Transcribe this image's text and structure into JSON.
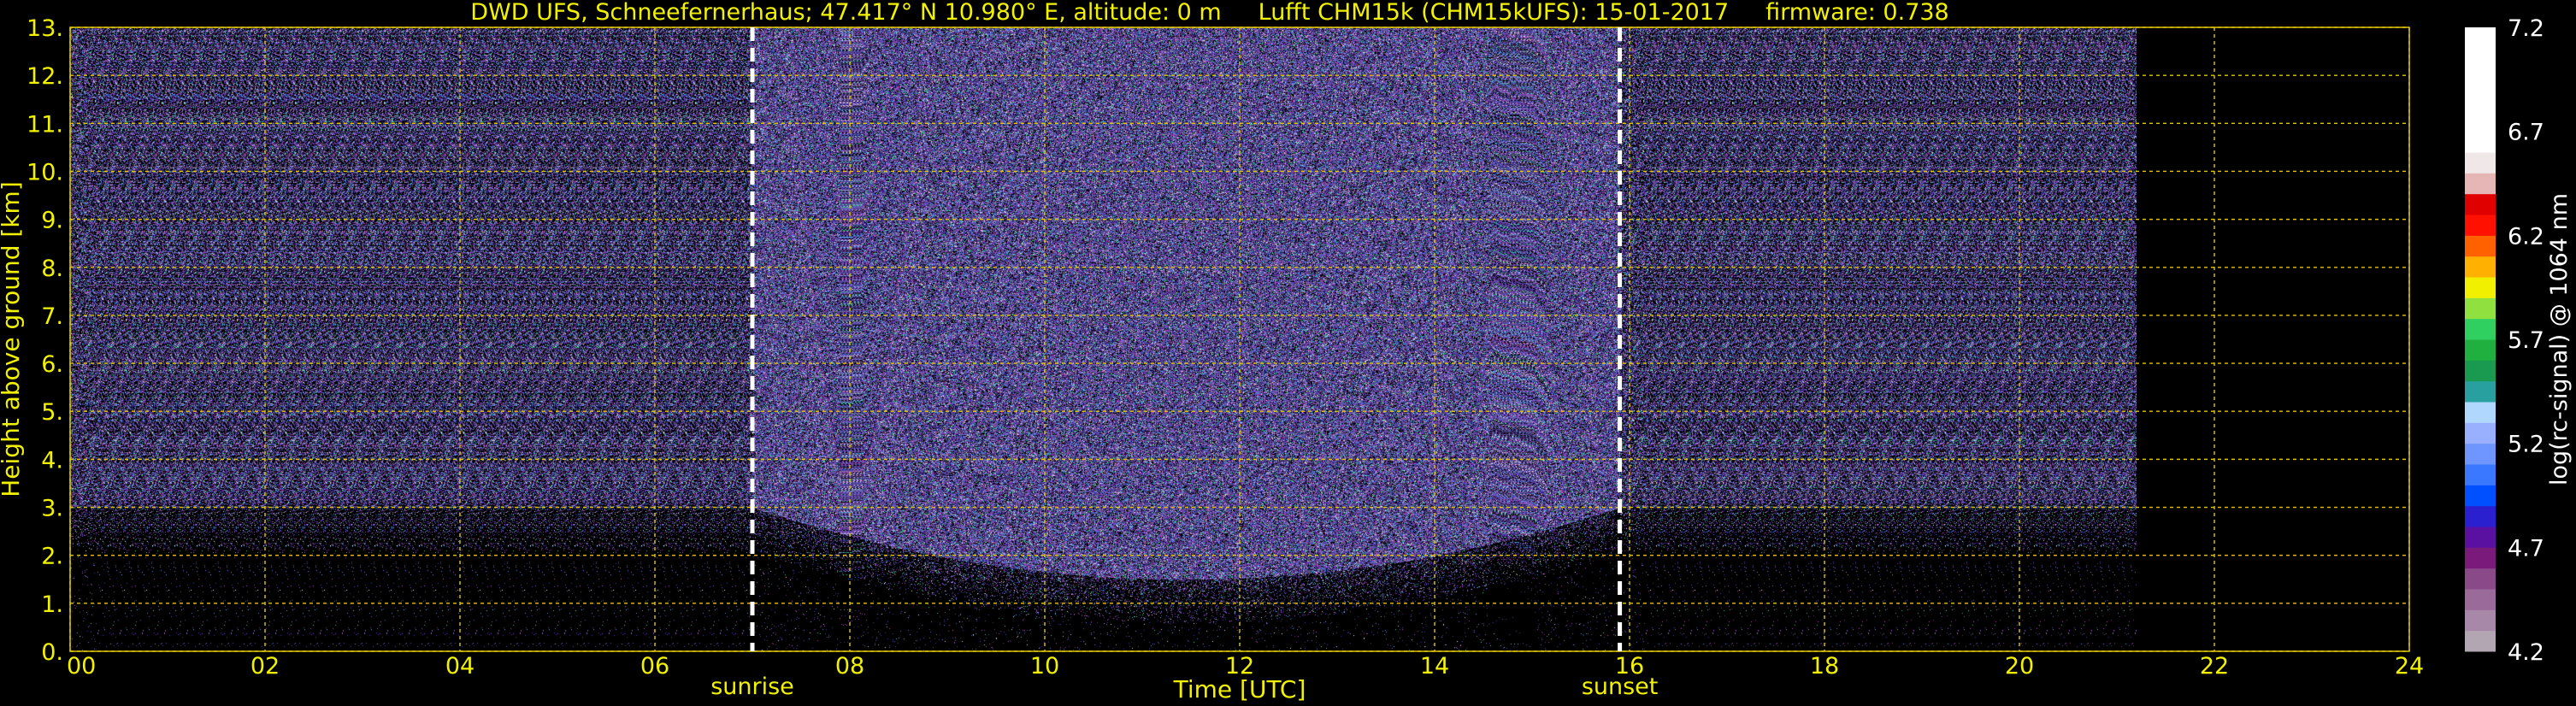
{
  "chart_data": {
    "type": "heatmap",
    "title_parts": [
      "DWD UFS, Schneefernerhaus; 47.417° N 10.980° E, altitude: 0 m",
      "Lufft CHM15k (CHM15kUFS): 15-01-2017",
      "firmware: 0.738"
    ],
    "xlabel": "Time [UTC]",
    "ylabel": "Height above ground [km]",
    "xlim": [
      0,
      24
    ],
    "ylim": [
      0,
      13
    ],
    "x_ticks": [
      0,
      2,
      4,
      6,
      8,
      10,
      12,
      14,
      16,
      18,
      20,
      22,
      24
    ],
    "x_tick_labels": [
      "00",
      "02",
      "04",
      "06",
      "08",
      "10",
      "12",
      "14",
      "16",
      "18",
      "20",
      "22",
      "24"
    ],
    "y_ticks": [
      0,
      1,
      2,
      3,
      4,
      5,
      6,
      7,
      8,
      9,
      10,
      11,
      12,
      13
    ],
    "y_tick_labels": [
      "0.",
      "1.",
      "2.",
      "3.",
      "4.",
      "5.",
      "6.",
      "7.",
      "8.",
      "9.",
      "10.",
      "11.",
      "12.",
      "13."
    ],
    "grid": true,
    "data_end_hour": 21.2,
    "noise_floor_km": {
      "night": 3.0,
      "day_minimum": 1.5
    },
    "events": [
      {
        "label": "sunrise",
        "time": 7.0
      },
      {
        "label": "sunset",
        "time": 15.9
      }
    ],
    "colorbar": {
      "label": "log(rc-signal) @ 1064 nm",
      "range": [
        4.2,
        7.2
      ],
      "ticks": [
        4.2,
        4.7,
        5.2,
        5.7,
        6.2,
        6.7,
        7.2
      ],
      "tick_labels": [
        "4.2",
        "4.7",
        "5.2",
        "5.7",
        "6.2",
        "6.7",
        "7.2"
      ],
      "colors": [
        "#b2a6b2",
        "#a888a8",
        "#9a6a9a",
        "#8a4a8a",
        "#7a1a7a",
        "#5a10a0",
        "#2a20d0",
        "#0050ff",
        "#3a78ff",
        "#6f96ff",
        "#98b0ff",
        "#b0d8ff",
        "#28a0a0",
        "#1a9a50",
        "#20b040",
        "#30d060",
        "#90e040",
        "#f0f000",
        "#ffb000",
        "#ff6000",
        "#ff1000",
        "#e00000",
        "#e6b6b6",
        "#f0e8e8",
        "#ffffff",
        "#ffffff",
        "#ffffff",
        "#ffffff",
        "#ffffff",
        "#ffffff"
      ]
    }
  },
  "colors": {
    "text": "#f2f200",
    "grid": "#e0c800",
    "event_line": "#ffffff",
    "background": "#000000",
    "noise_base": "#4a3e80"
  }
}
